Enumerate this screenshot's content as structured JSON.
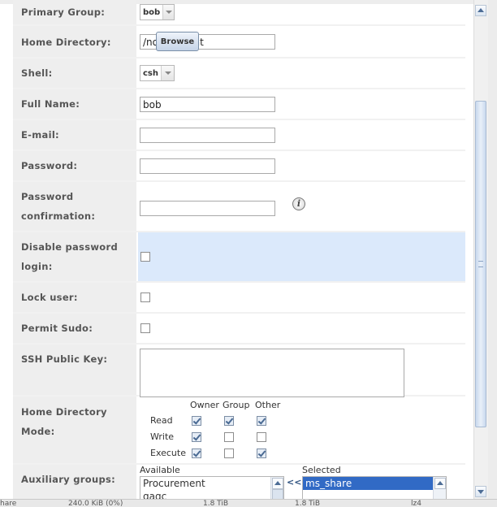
{
  "form": {
    "primary_group": {
      "label": "Primary Group:",
      "value": "bob"
    },
    "home_directory": {
      "label": "Home Directory:",
      "value": "/nonexistent",
      "browse_label": "Browse"
    },
    "shell": {
      "label": "Shell:",
      "value": "csh"
    },
    "full_name": {
      "label": "Full Name:",
      "value": "bob"
    },
    "email": {
      "label": "E-mail:",
      "value": ""
    },
    "password": {
      "label": "Password:",
      "value": ""
    },
    "password_confirmation": {
      "label_line1": "Password",
      "label_line2": "confirmation:",
      "value": ""
    },
    "disable_password_login": {
      "label_line1": "Disable password",
      "label_line2": "login:",
      "checked": false
    },
    "lock_user": {
      "label": "Lock user:",
      "checked": false
    },
    "permit_sudo": {
      "label": "Permit Sudo:",
      "checked": false
    },
    "ssh_public_key": {
      "label": "SSH Public Key:",
      "value": ""
    },
    "home_directory_mode": {
      "label_line1": "Home Directory",
      "label_line2": "Mode:",
      "columns": [
        "Owner",
        "Group",
        "Other"
      ],
      "rows": [
        {
          "name": "Read",
          "checked": [
            true,
            true,
            true
          ]
        },
        {
          "name": "Write",
          "checked": [
            true,
            false,
            false
          ]
        },
        {
          "name": "Execute",
          "checked": [
            true,
            false,
            true
          ]
        }
      ]
    },
    "auxiliary_groups": {
      "label": "Auxiliary groups:",
      "available_label": "Available",
      "selected_label": "Selected",
      "available": [
        "Procurement",
        "qagc"
      ],
      "selected": [
        "ms_share"
      ],
      "move_label": "<<"
    }
  },
  "underlay": {
    "cells": [
      "hare",
      "240.0 KiB (0%)",
      "1.8 TiB",
      "1.8 TiB",
      "lz4"
    ]
  },
  "colors": {
    "label_bg": "#eeeeee",
    "highlight_row": "#dbe9fb",
    "selection": "#316ac5"
  }
}
